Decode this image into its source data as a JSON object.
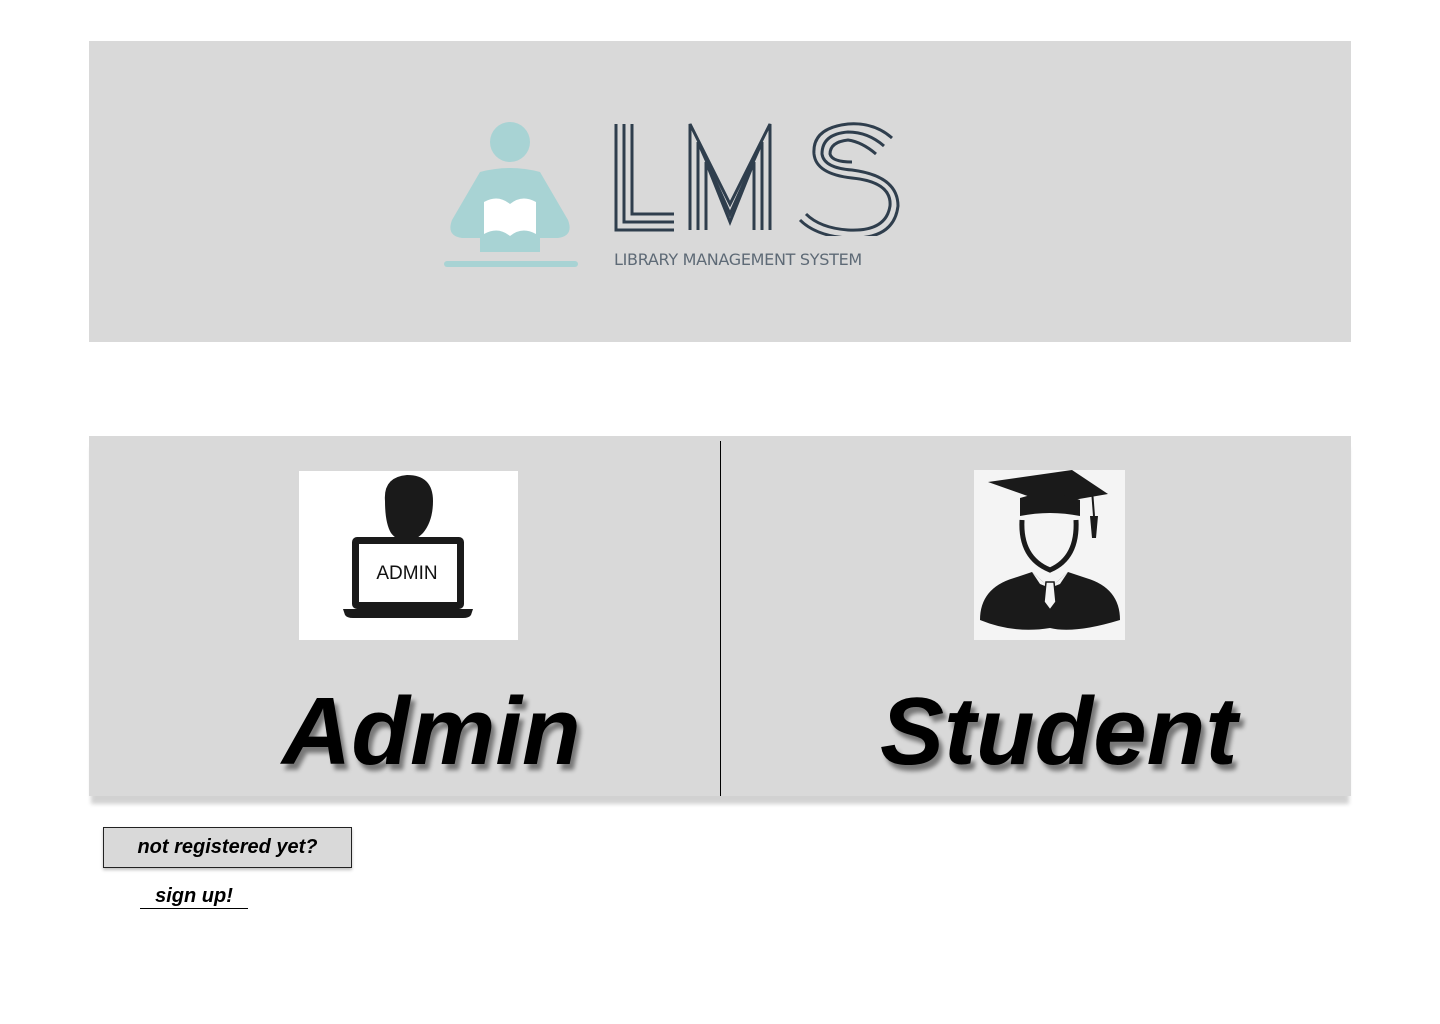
{
  "header": {
    "logo_text": "LMS",
    "logo_subtitle": "LIBRARY MANAGEMENT SYSTEM",
    "logo_icon": "reader-icon",
    "colors": {
      "banner_bg": "#d9d9d9",
      "logo_figure": "#a8d3d4",
      "logo_letters": "#2f3e4d"
    }
  },
  "roles": {
    "admin": {
      "icon": "admin-laptop-icon",
      "screen_label": "ADMIN",
      "title": "Admin"
    },
    "student": {
      "icon": "graduate-icon",
      "title": "Student"
    }
  },
  "register": {
    "prompt": "not registered yet?",
    "signup_label": "sign up!"
  }
}
